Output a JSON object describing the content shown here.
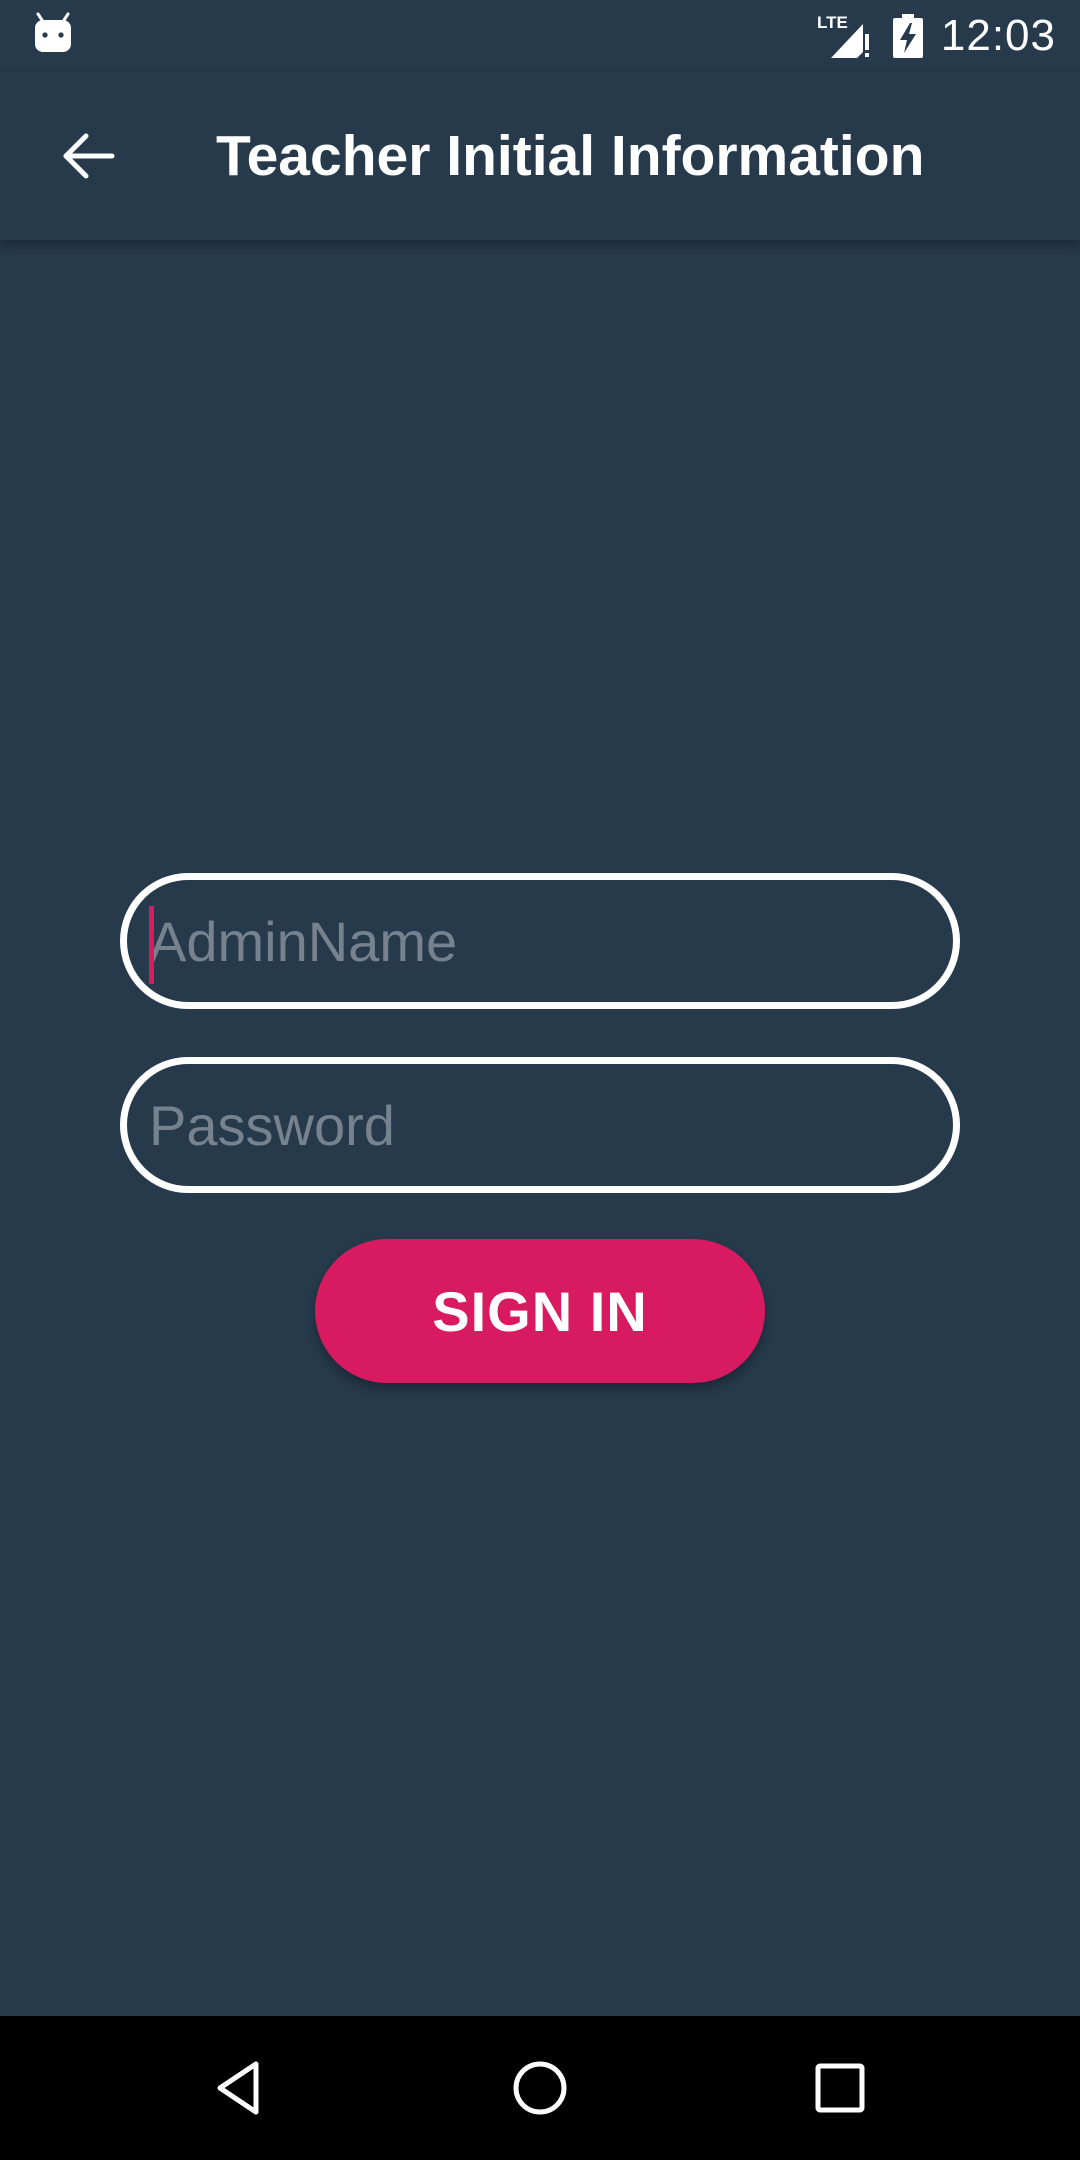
{
  "status_bar": {
    "left_icon": "android-robot-icon",
    "network_label": "LTE",
    "signal_icon": "cell-signal-alert-icon",
    "battery_icon": "battery-charging-icon",
    "time": "12:03"
  },
  "app_bar": {
    "back_icon": "arrow-back-icon",
    "title": "Teacher Initial Information"
  },
  "form": {
    "admin_name": {
      "value": "",
      "placeholder": "AdminName"
    },
    "password": {
      "value": "",
      "placeholder": "Password"
    },
    "sign_in_label": "SIGN IN"
  },
  "nav_bar": {
    "back_icon": "nav-back-triangle-icon",
    "home_icon": "nav-home-circle-icon",
    "recents_icon": "nav-recents-square-icon"
  },
  "colors": {
    "background": "#263a4c",
    "accent": "#d81b60",
    "placeholder": "#76838f",
    "nav_bar": "#000000"
  }
}
